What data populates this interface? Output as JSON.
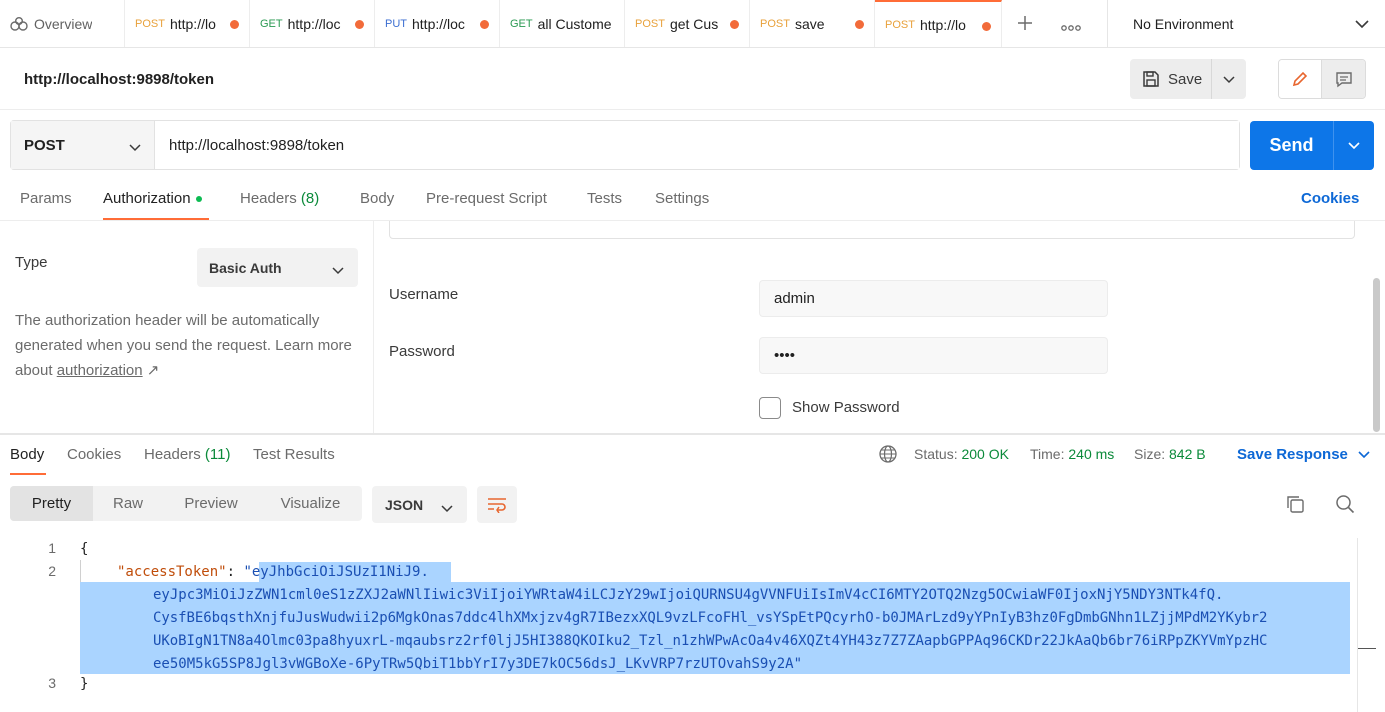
{
  "tabs": {
    "overview": "Overview",
    "items": [
      {
        "method": "POST",
        "name": "http://lo"
      },
      {
        "method": "GET",
        "name": "http://loc"
      },
      {
        "method": "PUT",
        "name": "http://loc"
      },
      {
        "method": "GET",
        "name": "all Custome"
      },
      {
        "method": "POST",
        "name": "get Cus"
      },
      {
        "method": "POST",
        "name": "save"
      },
      {
        "method": "POST",
        "name": "http://lo"
      }
    ],
    "environment": "No Environment"
  },
  "request": {
    "title": "http://localhost:9898/token",
    "save_label": "Save",
    "method": "POST",
    "url": "http://localhost:9898/token",
    "send_label": "Send"
  },
  "request_tabs": {
    "params": "Params",
    "authorization": "Authorization",
    "headers": "Headers",
    "headers_count": "(8)",
    "body": "Body",
    "prerequest": "Pre-request Script",
    "tests": "Tests",
    "settings": "Settings",
    "cookies": "Cookies"
  },
  "auth": {
    "type_label": "Type",
    "type_value": "Basic Auth",
    "description": "The authorization header will be automatically generated when you send the request. Learn more about ",
    "link_text": "authorization",
    "link_arrow": "↗",
    "username_label": "Username",
    "username_value": "admin",
    "password_label": "Password",
    "password_value": "••••",
    "show_password": "Show Password"
  },
  "response_tabs": {
    "body": "Body",
    "cookies": "Cookies",
    "headers": "Headers",
    "headers_count": "(11)",
    "test_results": "Test Results",
    "status_label": "Status:",
    "status_value": "200 OK",
    "time_label": "Time:",
    "time_value": "240 ms",
    "size_label": "Size:",
    "size_value": "842 B",
    "save_response": "Save Response"
  },
  "response_toolbar": {
    "pretty": "Pretty",
    "raw": "Raw",
    "preview": "Preview",
    "visualize": "Visualize",
    "language": "JSON"
  },
  "code": {
    "line_numbers": [
      "1",
      "2",
      "3"
    ],
    "open_brace": "{",
    "close_brace": "}",
    "key": "\"accessToken\"",
    "colon": ": ",
    "quote_open": "\"",
    "quote_close": "\"",
    "token_lines": [
      "eyJhbGciOiJSUzI1NiJ9.",
      "eyJpc3MiOiJzZWN1cml0eS1zZXJ2aWNlIiwic3ViIjoiYWRtaW4iLCJzY29wIjoiQURNSU4gVVNFUiIsImV4cCI6MTY2OTQ2Nzg5OCwiaWF0IjoxNjY5NDY3NTk4fQ.",
      "CysfBE6bqsthXnjfuJusWudwii2p6MgkOnas7ddc4lhXMxjzv4gR7IBezxXQL9vzLFcoFHl_vsYSpEtPQcyrhO-b0JMArLzd9yYPnIyB3hz0FgDmbGNhn1LZjjMPdM2YKybr2",
      "UKoBIgN1TN8a4Olmc03pa8hyuxrL-mqaubsrz2rf0ljJ5HI388QKOIku2_Tzl_n1zhWPwAcOa4v46XQZt4YH43z7Z7ZAapbGPPAq96CKDr22JkAaQb6br76iRPpZKYVmYpzHC",
      "ee50M5kG5SP8Jgl3vWGBoXe-6PyTRw5QbiT1bbYrI7y3DE7kOC56dsJ_LKvVRP7rzUTOvahS9y2A"
    ]
  },
  "colors": {
    "accent": "#ff6c37",
    "primary": "#0d76e8",
    "success": "#0b8a3a",
    "selection": "#aad4ff"
  }
}
